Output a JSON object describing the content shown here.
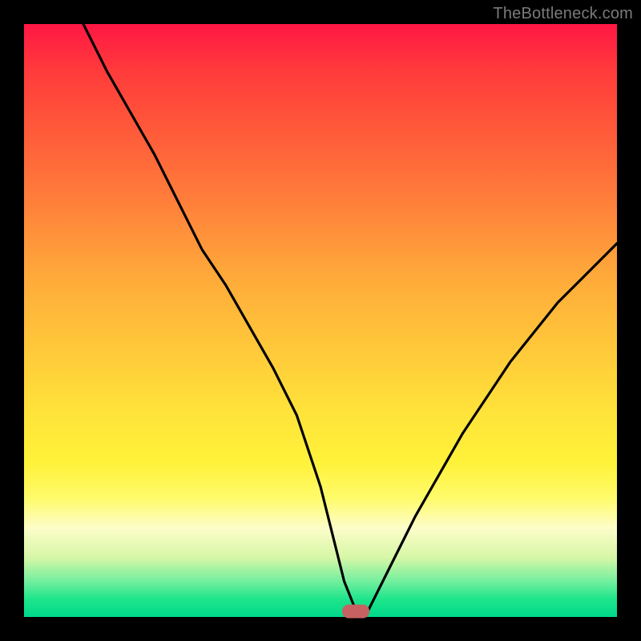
{
  "watermark": "TheBottleneck.com",
  "colors": {
    "frame": "#000000",
    "curve": "#000000",
    "marker": "#c86262"
  },
  "chart_data": {
    "type": "line",
    "title": "",
    "xlabel": "",
    "ylabel": "",
    "xlim": [
      0,
      100
    ],
    "ylim": [
      0,
      100
    ],
    "grid": false,
    "legend": false,
    "annotations": [
      {
        "kind": "marker",
        "x": 56,
        "y": 1
      }
    ],
    "series": [
      {
        "name": "bottleneck-curve",
        "x": [
          10,
          14,
          18,
          22,
          26,
          30,
          34,
          38,
          42,
          46,
          50,
          52,
          54,
          56,
          58,
          62,
          66,
          70,
          74,
          78,
          82,
          86,
          90,
          94,
          98,
          100
        ],
        "values": [
          100,
          92,
          85,
          78,
          70,
          62,
          56,
          49,
          42,
          34,
          22,
          14,
          6,
          1,
          1,
          9,
          17,
          24,
          31,
          37,
          43,
          48,
          53,
          57,
          61,
          63
        ]
      }
    ]
  }
}
